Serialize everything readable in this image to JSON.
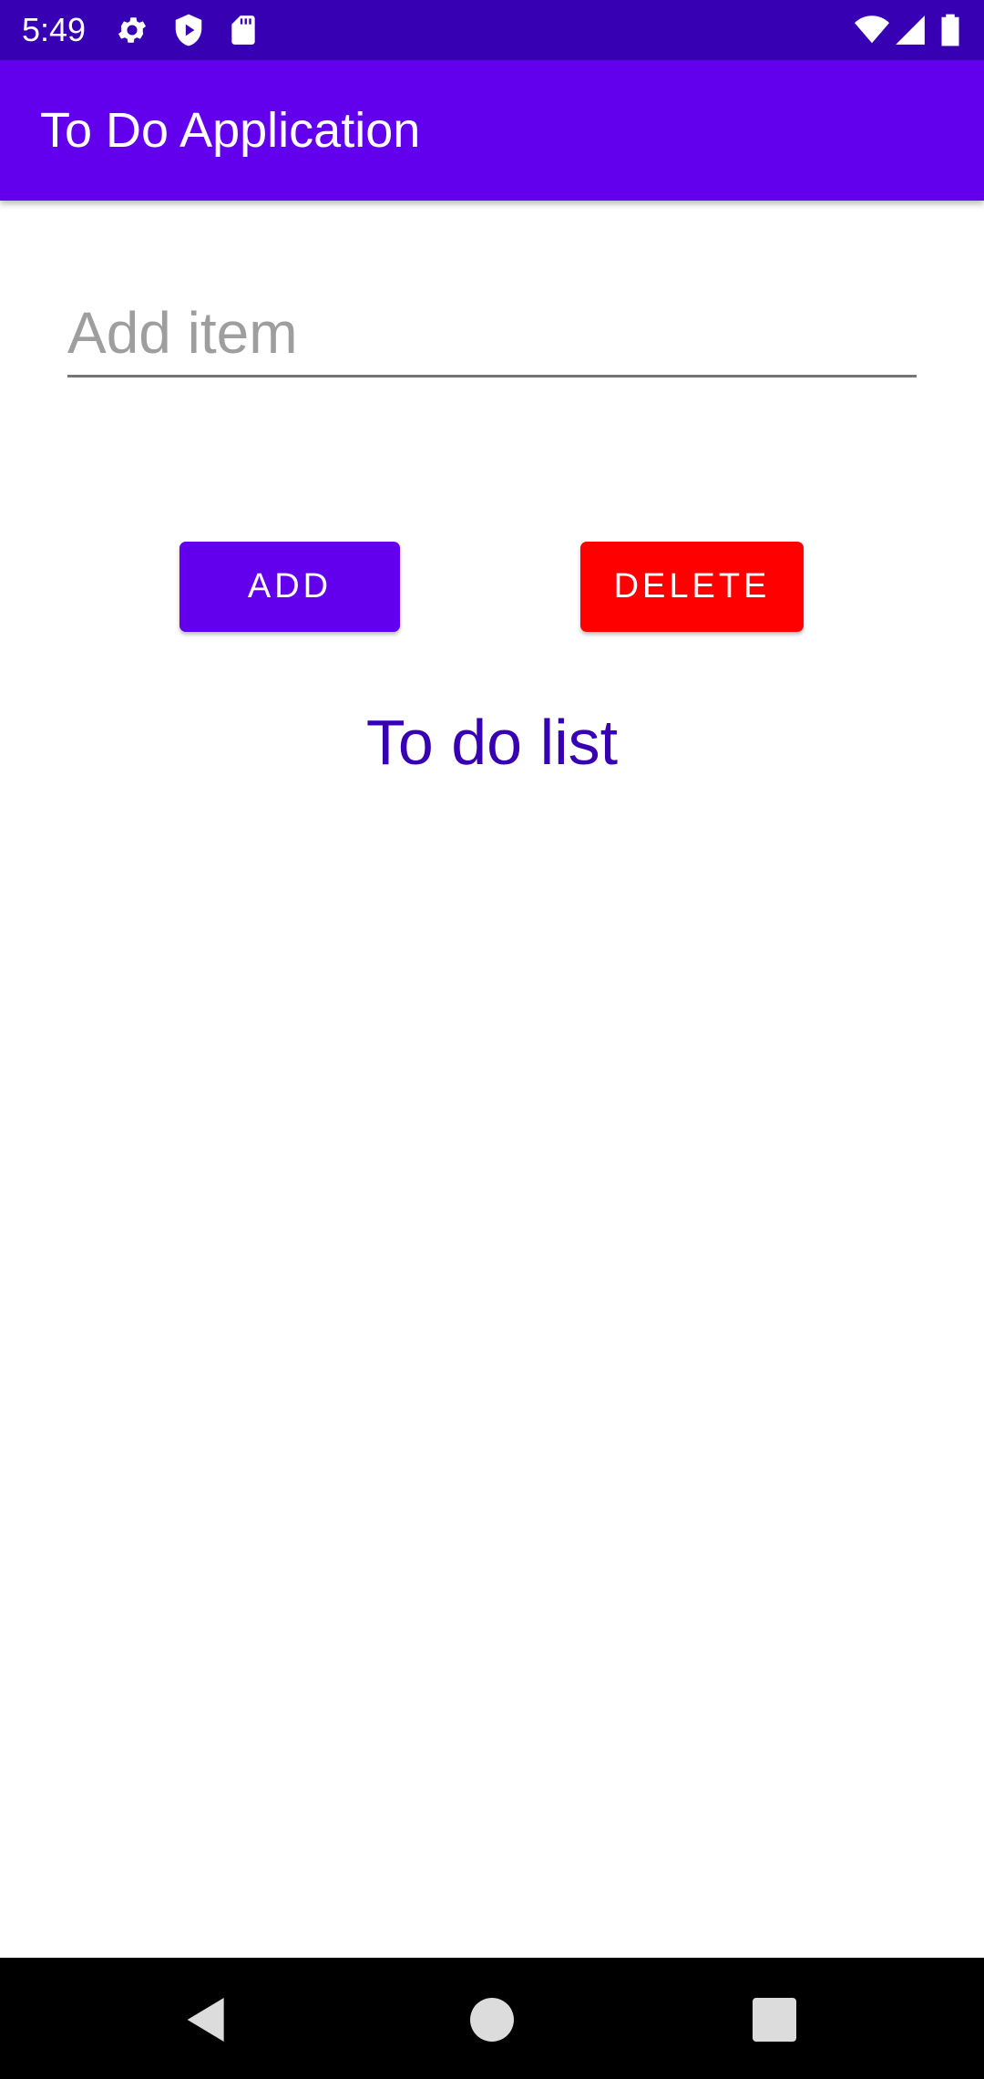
{
  "status_bar": {
    "time": "5:49",
    "icons": [
      "gear-icon",
      "shield-play-icon",
      "sd-card-icon",
      "wifi-icon",
      "cell-signal-icon",
      "battery-icon"
    ]
  },
  "app_bar": {
    "title": "To Do Application"
  },
  "input": {
    "placeholder": "Add item",
    "value": ""
  },
  "buttons": {
    "add_label": "ADD",
    "delete_label": "DELETE"
  },
  "list": {
    "heading": "To do list",
    "items": []
  },
  "nav_bar": {
    "icons": [
      "back-icon",
      "home-icon",
      "recents-icon"
    ]
  },
  "colors": {
    "status_bar": "#3700b3",
    "app_bar": "#6200ee",
    "add_button": "#6200ee",
    "delete_button": "#ff0000",
    "heading_text": "#3700b3"
  }
}
